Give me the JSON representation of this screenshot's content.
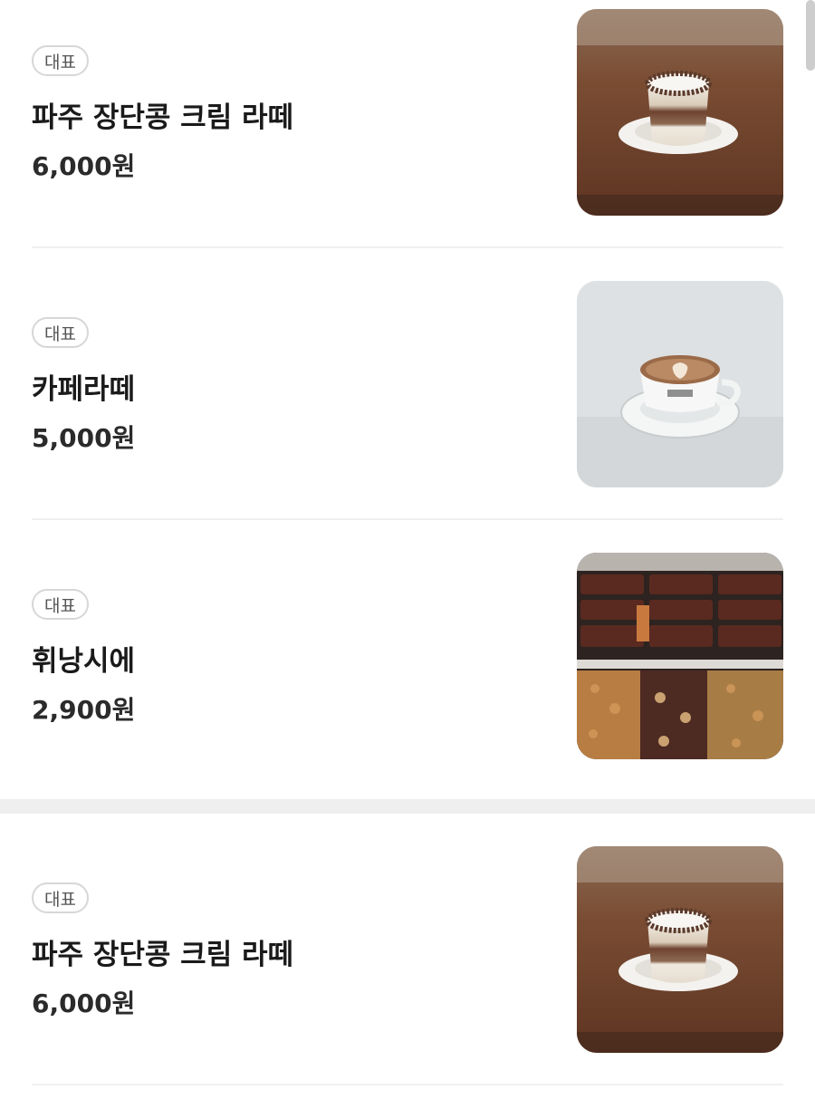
{
  "menu_items": [
    {
      "badge": "대표",
      "name": "파주 장단콩 크림 라떼",
      "price": "6,000원",
      "image": "cream-latte-photo"
    },
    {
      "badge": "대표",
      "name": "카페라떼",
      "price": "5,000원",
      "image": "cafe-latte-photo"
    },
    {
      "badge": "대표",
      "name": "휘낭시에",
      "price": "2,900원",
      "image": "financier-photo"
    },
    {
      "badge": "대표",
      "name": "파주 장단콩 크림 라떼",
      "price": "6,000원",
      "image": "cream-latte-photo"
    }
  ]
}
